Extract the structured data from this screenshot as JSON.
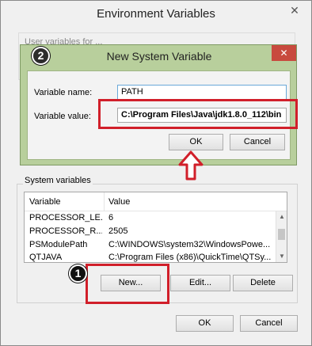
{
  "window": {
    "title": "Environment Variables",
    "close_glyph": "✕"
  },
  "user_group": {
    "label": "User variables for ..."
  },
  "dialog": {
    "title": "New System Variable",
    "close_glyph": "✕",
    "name_label": "Variable name:",
    "name_value": "PATH",
    "value_label": "Variable value:",
    "value_value": "C:\\Program Files\\Java\\jdk1.8.0_112\\bin",
    "ok_label": "OK",
    "cancel_label": "Cancel"
  },
  "annotations": {
    "badge_2": "2",
    "badge_1": "1",
    "highlight_color": "#d11f2a"
  },
  "system_variables": {
    "label": "System variables",
    "columns": [
      "Variable",
      "Value"
    ],
    "rows": [
      {
        "variable": "PROCESSOR_LE...",
        "value": "6"
      },
      {
        "variable": "PROCESSOR_R...",
        "value": "2505"
      },
      {
        "variable": "PSModulePath",
        "value": "C:\\WINDOWS\\system32\\WindowsPowe..."
      },
      {
        "variable": "QTJAVA",
        "value": "C:\\Program Files (x86)\\QuickTime\\QTSy..."
      }
    ],
    "new_label": "New...",
    "edit_label": "Edit...",
    "delete_label": "Delete"
  },
  "footer": {
    "ok_label": "OK",
    "cancel_label": "Cancel"
  },
  "icons": [
    "close-icon",
    "scroll-up-icon",
    "scroll-down-icon",
    "red-arrow-icon"
  ]
}
